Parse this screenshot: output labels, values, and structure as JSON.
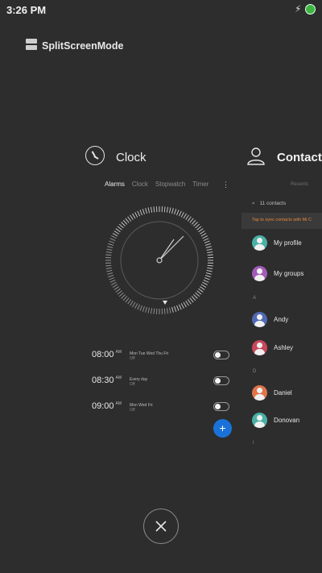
{
  "status_bar": {
    "time": "3:26 PM",
    "charging_icon": "lightning-icon",
    "battery_color": "#3fb541"
  },
  "header": {
    "title": "SplitScreenMode",
    "icon": "split-screen-icon"
  },
  "clock_app": {
    "title": "Clock",
    "icon": "clock-icon",
    "tabs": [
      {
        "label": "Alarms",
        "active": true
      },
      {
        "label": "Clock",
        "active": false
      },
      {
        "label": "Stopwatch",
        "active": false
      },
      {
        "label": "Timer",
        "active": false
      }
    ],
    "more_icon": "kebab-menu-icon",
    "alarms": [
      {
        "time": "08:00",
        "ampm": "AM",
        "days": "Mon Tue Wed Thu Fri",
        "state": "Off"
      },
      {
        "time": "08:30",
        "ampm": "AM",
        "days": "Every day",
        "state": "Off"
      },
      {
        "time": "09:00",
        "ampm": "AM",
        "days": "Mon Wed Fri",
        "state": "Off"
      }
    ],
    "add_button": "+",
    "accent_color": "#1a72d9"
  },
  "contacts_app": {
    "title": "Contacts",
    "icon": "person-icon",
    "recents_label": "Recents",
    "search_text": "11 contacts",
    "sync_banner": "Tap to sync contacts with Mi C",
    "sync_color": "#e8883a",
    "items": [
      {
        "type": "contact",
        "name": "My profile",
        "color": "#4ab0a6"
      },
      {
        "type": "contact",
        "name": "My groups",
        "color": "#a35bb8"
      },
      {
        "type": "header",
        "letter": "A"
      },
      {
        "type": "contact",
        "name": "Andy",
        "color": "#5169b5"
      },
      {
        "type": "contact",
        "name": "Ashley",
        "color": "#c9485b"
      },
      {
        "type": "header",
        "letter": "D"
      },
      {
        "type": "contact",
        "name": "Daniel",
        "color": "#e0744a"
      },
      {
        "type": "contact",
        "name": "Donovan",
        "color": "#4ab0a6"
      },
      {
        "type": "header",
        "letter": "I"
      }
    ]
  },
  "close_button": "close-icon"
}
